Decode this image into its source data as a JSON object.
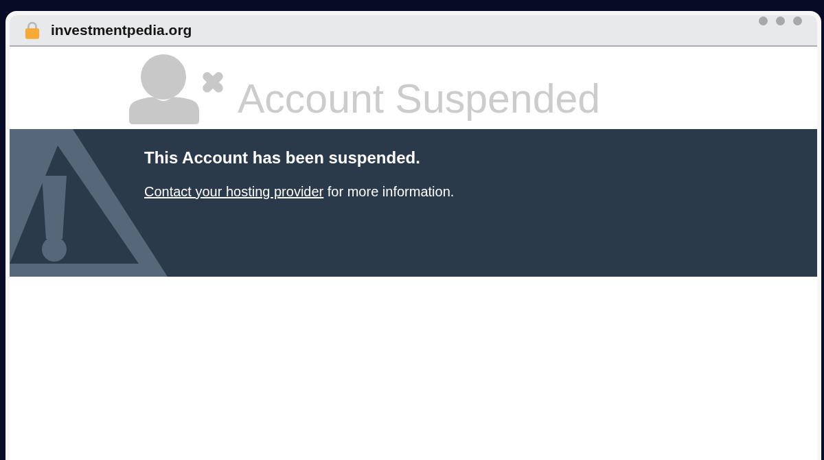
{
  "browser": {
    "address": "investmentpedia.org"
  },
  "page": {
    "title": "Account Suspended",
    "notice": {
      "heading": "This Account has been suspended.",
      "link": "Contact your hosting provider",
      "text": "for more information."
    }
  }
}
